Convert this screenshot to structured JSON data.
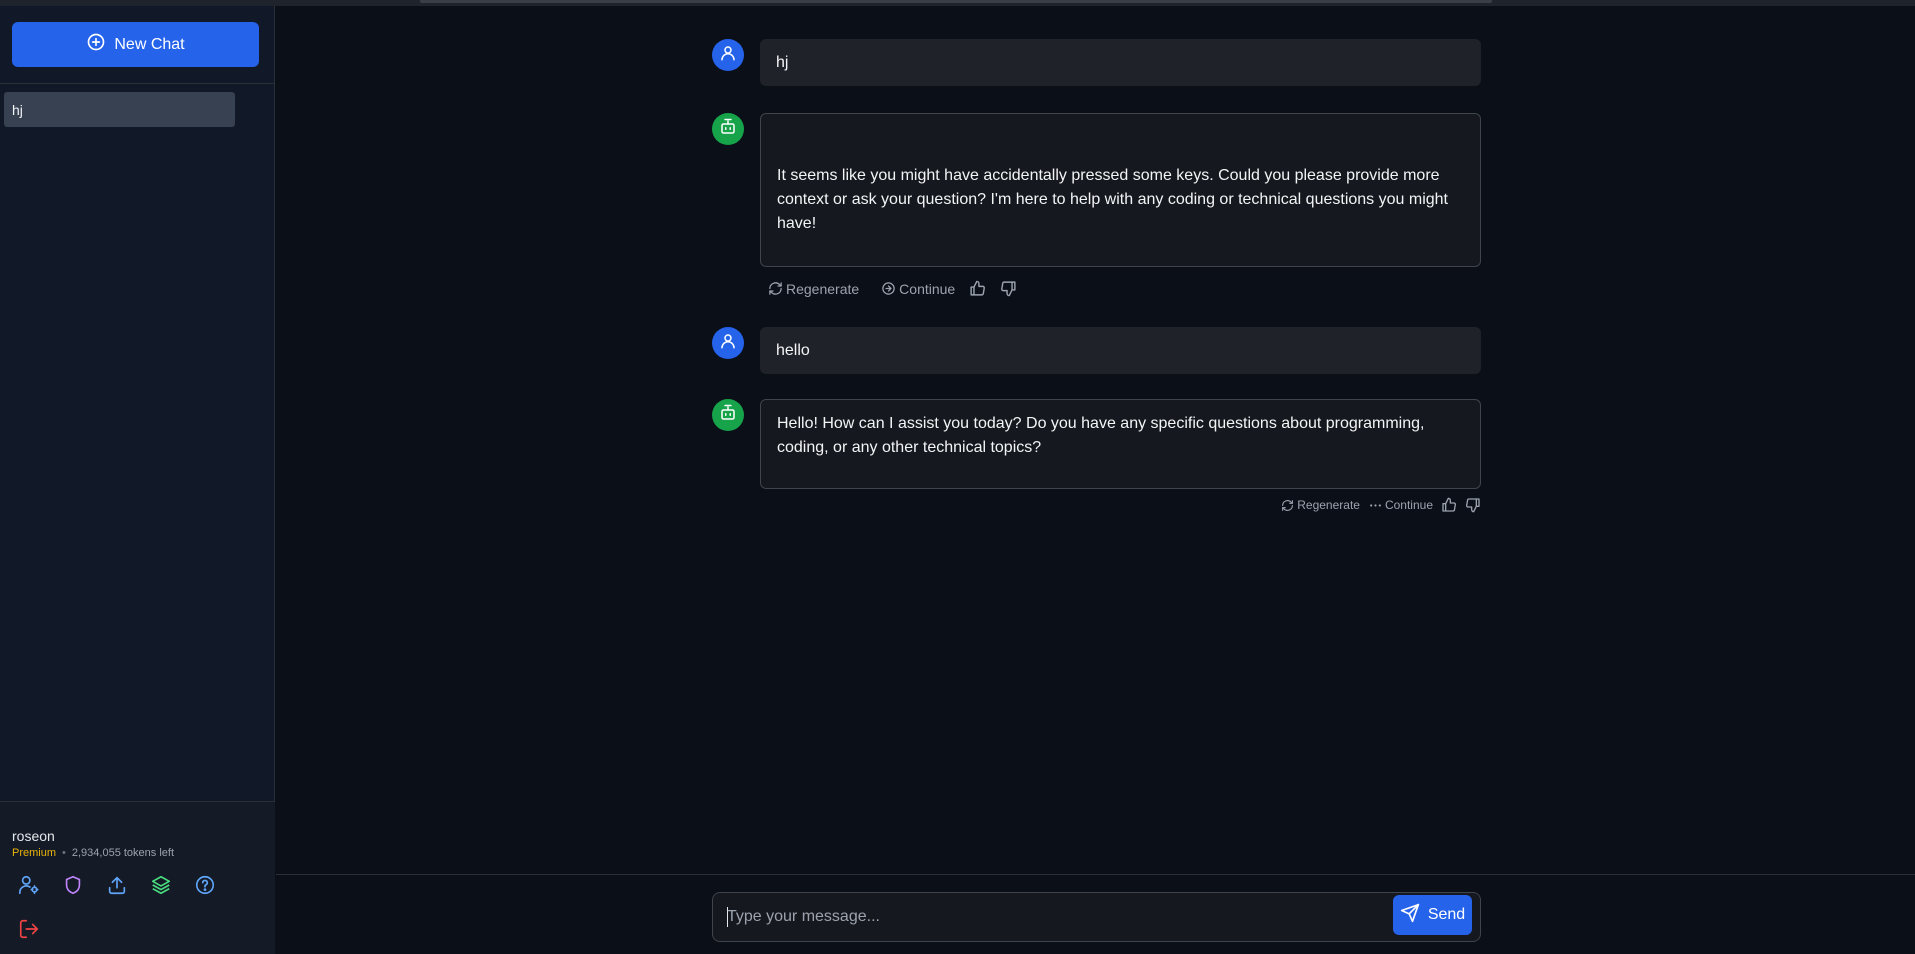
{
  "sidebar": {
    "new_chat_label": "New Chat",
    "chats": [
      {
        "label": "hj"
      }
    ],
    "user": {
      "name": "roseon",
      "plan": "Premium",
      "tokens": "2,934,055 tokens left"
    },
    "icons": [
      "user-settings-icon",
      "shield-icon",
      "upload-icon",
      "layers-icon",
      "help-icon",
      "logout-icon"
    ]
  },
  "messages": [
    {
      "role": "user",
      "text": "hj"
    },
    {
      "role": "assistant",
      "text": "It seems like you might have accidentally pressed some keys. Could you please provide more context or ask your question? I'm here to help with any coding or technical questions you might have!"
    },
    {
      "role": "user",
      "text": "hello"
    },
    {
      "role": "assistant",
      "text": "Hello! How can I assist you today? Do you have any specific questions about programming, coding, or any other technical topics?"
    }
  ],
  "actions": {
    "regenerate_label": "Regenerate",
    "continue_label": "Continue"
  },
  "composer": {
    "placeholder": "Type your message...",
    "send_label": "Send"
  },
  "colors": {
    "accent": "#2563eb",
    "bot_avatar": "#16a34a",
    "premium": "#eab308",
    "logout": "#ef4444"
  }
}
